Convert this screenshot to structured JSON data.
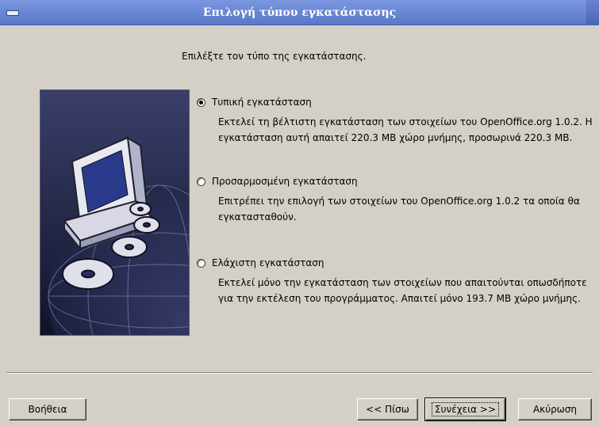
{
  "window": {
    "title": "Επιλογή τύπου εγκατάστασης"
  },
  "prompt": "Επιλέξτε τον τύπο της εγκατάστασης.",
  "options": [
    {
      "label": "Τυπική εγκατάσταση",
      "selected": true,
      "description": "Εκτελεί τη βέλτιστη εγκατάσταση των στοιχείων του OpenOffice.org 1.0.2. Η εγκατάσταση αυτή απαιτεί 220.3 MB χώρο μνήμης, προσωρινά 220.3 MB."
    },
    {
      "label": "Προσαρμοσμένη εγκατάσταση",
      "selected": false,
      "description": "Επιτρέπει την επιλογή των στοιχείων του OpenOffice.org 1.0.2 τα οποία θα εγκατασταθούν."
    },
    {
      "label": "Ελάχιστη εγκατάσταση",
      "selected": false,
      "description": "Εκτελεί μόνο την εγκατάσταση των στοιχείων που απαιτούνται οπωσδήποτε για την εκτέλεση του προγράμματος. Απαιτεί μόνο 193.7 MB χώρο μνήμης."
    }
  ],
  "buttons": {
    "help": "Βοήθεια",
    "back": "<< Πίσω",
    "next": "Συνέχεια >>",
    "cancel": "Ακύρωση"
  },
  "colors": {
    "titlebar": "#5b78c8",
    "background": "#d4d0c8",
    "illustration": "#1a1f3a"
  }
}
